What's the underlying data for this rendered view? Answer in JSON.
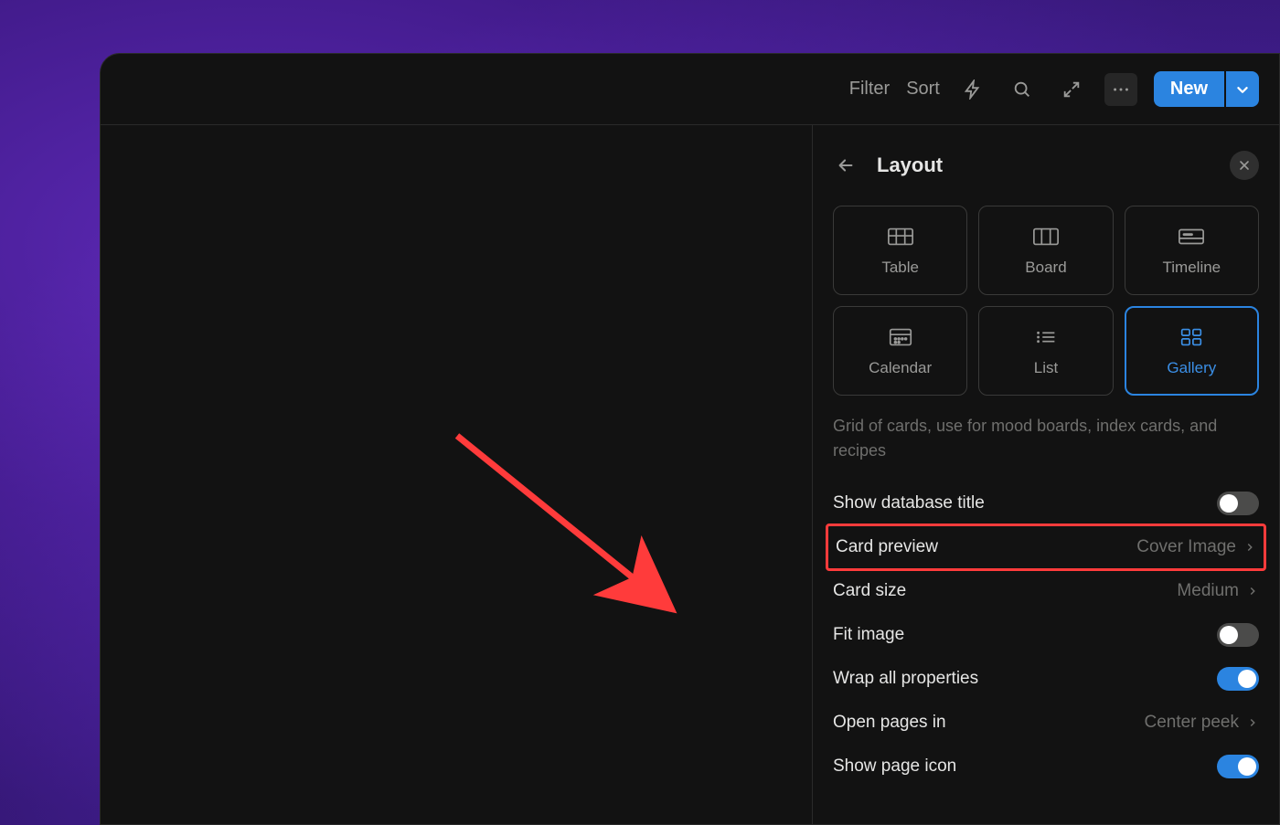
{
  "toolbar": {
    "filter_label": "Filter",
    "sort_label": "Sort",
    "new_label": "New"
  },
  "panel": {
    "title": "Layout",
    "views": [
      {
        "id": "table",
        "label": "Table",
        "selected": false
      },
      {
        "id": "board",
        "label": "Board",
        "selected": false
      },
      {
        "id": "timeline",
        "label": "Timeline",
        "selected": false
      },
      {
        "id": "calendar",
        "label": "Calendar",
        "selected": false
      },
      {
        "id": "list",
        "label": "List",
        "selected": false
      },
      {
        "id": "gallery",
        "label": "Gallery",
        "selected": true
      }
    ],
    "description": "Grid of cards, use for mood boards, index cards, and recipes",
    "options": {
      "show_db_title": {
        "label": "Show database title",
        "value": false,
        "type": "toggle"
      },
      "card_preview": {
        "label": "Card preview",
        "value": "Cover Image",
        "type": "select"
      },
      "card_size": {
        "label": "Card size",
        "value": "Medium",
        "type": "select"
      },
      "fit_image": {
        "label": "Fit image",
        "value": false,
        "type": "toggle"
      },
      "wrap_props": {
        "label": "Wrap all properties",
        "value": true,
        "type": "toggle"
      },
      "open_pages_in": {
        "label": "Open pages in",
        "value": "Center peek",
        "type": "select"
      },
      "show_page_icon": {
        "label": "Show page icon",
        "value": true,
        "type": "toggle"
      }
    }
  }
}
